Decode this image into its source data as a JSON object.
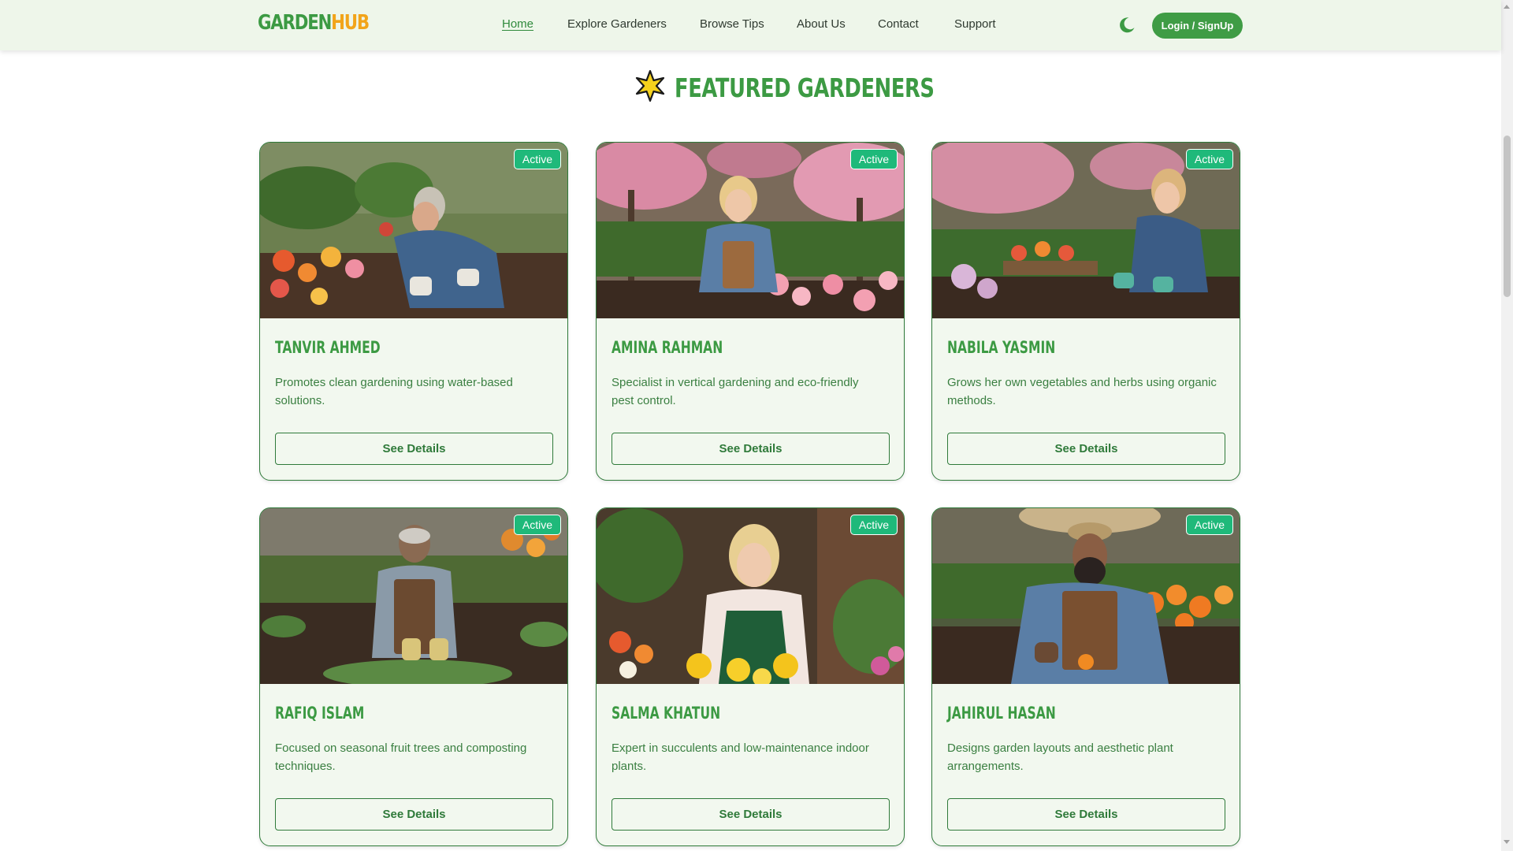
{
  "brand": {
    "part1": "GARDEN",
    "part2": "HUB"
  },
  "nav": {
    "items": [
      {
        "label": "Home",
        "active": true
      },
      {
        "label": "Explore Gardeners",
        "active": false
      },
      {
        "label": "Browse Tips",
        "active": false
      },
      {
        "label": "About Us",
        "active": false
      },
      {
        "label": "Contact",
        "active": false
      },
      {
        "label": "Support",
        "active": false
      }
    ],
    "theme_toggle_icon": "moon-icon",
    "login_label": "Login / SignUp"
  },
  "section": {
    "icon": "star-icon",
    "title": "FEATURED GARDENERS"
  },
  "cards": [
    {
      "name": "TANVIR AHMED",
      "status": "Active",
      "description": "Promotes clean gardening using water-based solutions.",
      "button": "See Details"
    },
    {
      "name": "AMINA RAHMAN",
      "status": "Active",
      "description": "Specialist in vertical gardening and eco-friendly pest control.",
      "button": "See Details"
    },
    {
      "name": "NABILA YASMIN",
      "status": "Active",
      "description": "Grows her own vegetables and herbs using organic methods.",
      "button": "See Details"
    },
    {
      "name": "RAFIQ ISLAM",
      "status": "Active",
      "description": "Focused on seasonal fruit trees and composting techniques.",
      "button": "See Details"
    },
    {
      "name": "SALMA KHATUN",
      "status": "Active",
      "description": "Expert in succulents and low-maintenance indoor plants.",
      "button": "See Details"
    },
    {
      "name": "JAHIRUL HASAN",
      "status": "Active",
      "description": "Designs garden layouts and aesthetic plant arrangements.",
      "button": "See Details"
    }
  ],
  "colors": {
    "primary_green": "#3c9a43",
    "accent_orange": "#f2a41a",
    "badge_green": "#1fb97a",
    "card_bg": "#f2f8ef",
    "nav_bg": "#eef6ea"
  }
}
